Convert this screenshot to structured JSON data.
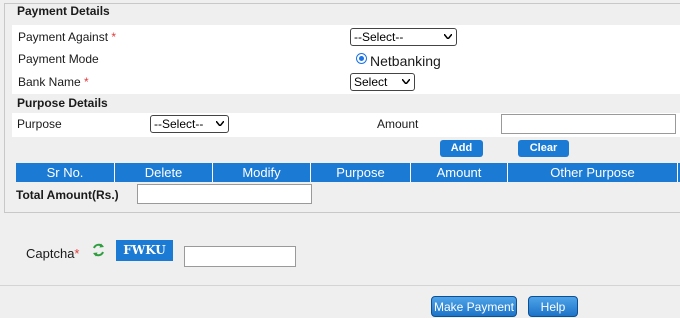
{
  "payment_details": {
    "title": "Payment Details",
    "payment_against_label": "Payment Against",
    "payment_against_value": "--Select--",
    "payment_mode_label": "Payment Mode",
    "payment_mode_option": "Netbanking",
    "bank_name_label": "Bank Name",
    "bank_name_value": "Select",
    "required_marker": "*"
  },
  "purpose_details": {
    "title": "Purpose Details",
    "purpose_label": "Purpose",
    "purpose_value": "--Select--",
    "amount_label": "Amount",
    "amount_value": "",
    "add_label": "Add",
    "clear_label": "Clear"
  },
  "table": {
    "headers": [
      "Sr No.",
      "Delete",
      "Modify",
      "Purpose",
      "Amount",
      "Other Purpose"
    ]
  },
  "total": {
    "label": "Total Amount(Rs.)",
    "value": ""
  },
  "captcha": {
    "label": "Captcha",
    "required_marker": "*",
    "code": "FWKU",
    "input_value": ""
  },
  "actions": {
    "make_payment_label": "Make Payment",
    "help_label": "Help"
  },
  "colors": {
    "accent": "#1a7ad4",
    "required": "#e23b3b",
    "refresh_icon": "#2e9e3e"
  }
}
